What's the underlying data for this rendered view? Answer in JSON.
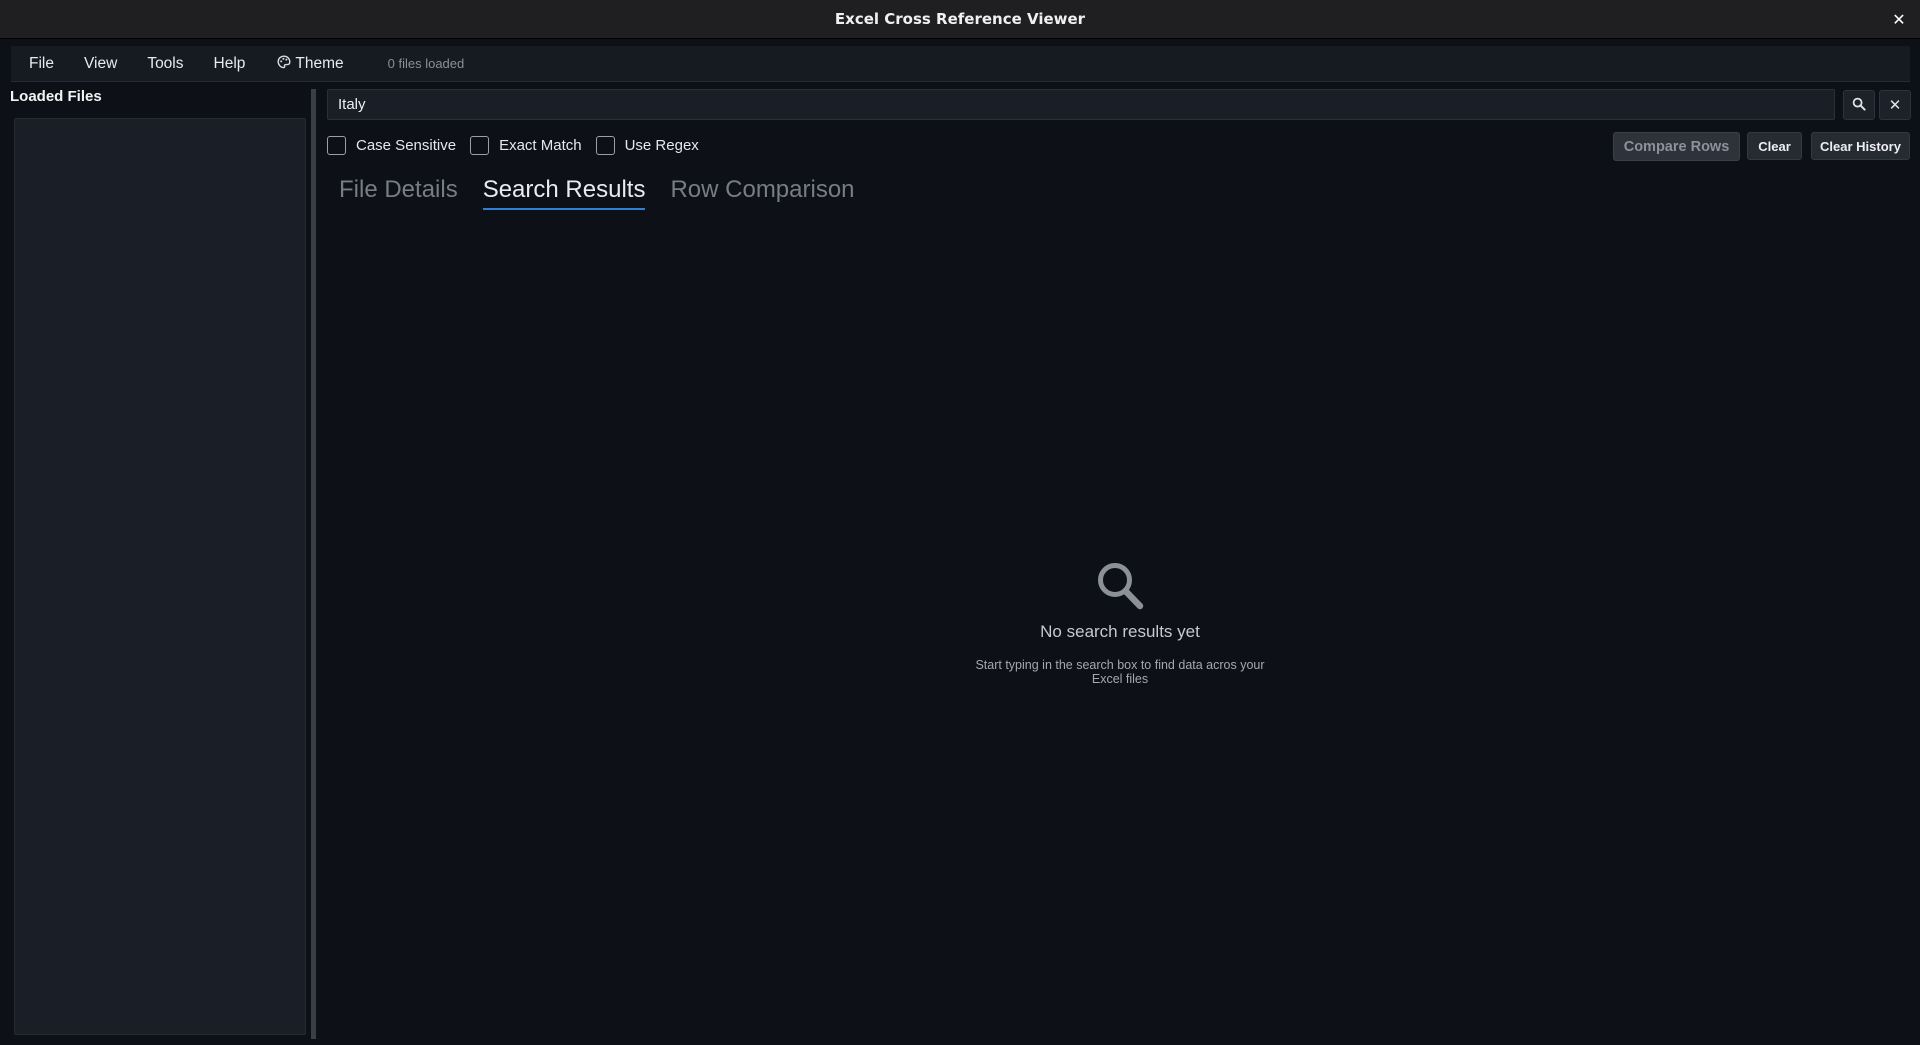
{
  "window": {
    "title": "Excel Cross Reference Viewer",
    "close_glyph": "✕"
  },
  "menubar": {
    "items": [
      {
        "label": "File"
      },
      {
        "label": "View"
      },
      {
        "label": "Tools"
      },
      {
        "label": "Help"
      }
    ],
    "theme_label": "Theme",
    "theme_icon": "palette-icon",
    "status": "0 files loaded"
  },
  "sidebar": {
    "header": "Loaded Files"
  },
  "search": {
    "value": "Italy",
    "search_icon": "search-icon",
    "clear_glyph": "✕"
  },
  "options": {
    "case_sensitive": {
      "label": "Case Sensitive",
      "checked": false
    },
    "exact_match": {
      "label": "Exact Match",
      "checked": false
    },
    "use_regex": {
      "label": "Use Regex",
      "checked": false
    }
  },
  "actions": {
    "compare_rows": "Compare Rows",
    "clear": "Clear",
    "clear_history": "Clear History"
  },
  "tabs": [
    {
      "label": "File Details",
      "active": false
    },
    {
      "label": "Search Results",
      "active": true
    },
    {
      "label": "Row Comparison",
      "active": false
    }
  ],
  "empty_state": {
    "icon": "search-icon",
    "title": "No search results yet",
    "subtitle": "Start typing in the search box to find data acros your Excel files"
  },
  "colors": {
    "background": "#0d1016",
    "panel": "#1a1e26",
    "accent": "#2f7fd6"
  }
}
